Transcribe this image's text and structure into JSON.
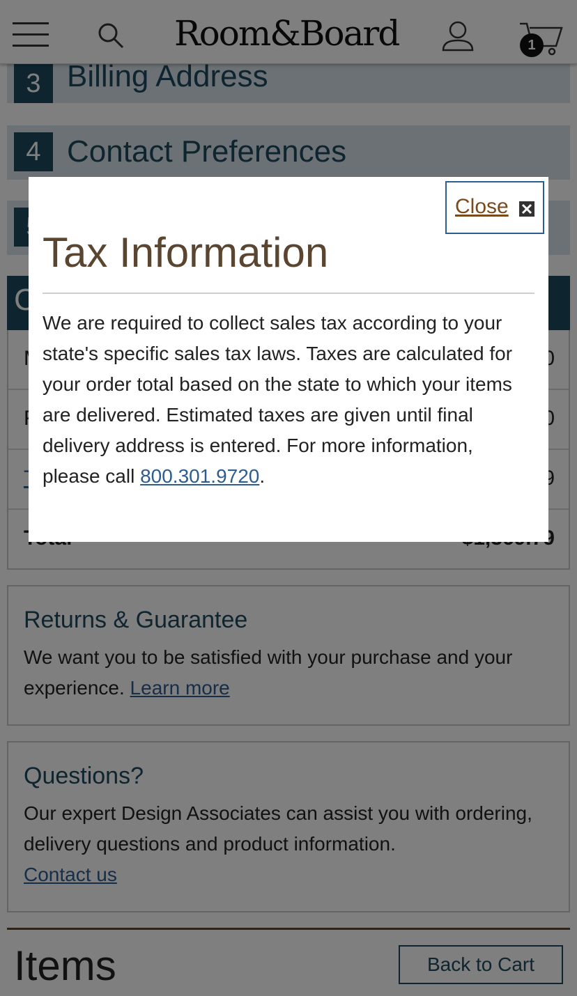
{
  "header": {
    "logo": "Room&Board",
    "cart_count": "1"
  },
  "steps": [
    {
      "num": "3",
      "title": "Billing Address"
    },
    {
      "num": "4",
      "title": "Contact Preferences"
    },
    {
      "num": "5"
    }
  ],
  "summary": {
    "heading": "C",
    "rows": [
      {
        "label": "M",
        "value": "0"
      },
      {
        "label": "F",
        "value": "0"
      },
      {
        "label": "T",
        "value": "9"
      },
      {
        "label": "Total",
        "value": "$1,369.79"
      }
    ]
  },
  "returns": {
    "title": "Returns & Guarantee",
    "text": "We want you to be satisfied with your purchase and your experience.",
    "link": "Learn more"
  },
  "questions": {
    "title": "Questions?",
    "text": "Our expert Design Associates can assist you with ordering, delivery questions and product information.",
    "link": "Contact us"
  },
  "items": {
    "title": "Items",
    "back_to_cart": "Back to Cart"
  },
  "modal": {
    "close_label": "Close",
    "title": "Tax Information",
    "body": "We are required to collect sales tax according to your state's specific sales tax laws. Taxes are calculated for your order total based on the state to which your items are delivered. Estimated taxes are given until final delivery address is entered. For more information, please call",
    "phone": "800.301.9720",
    "period": "."
  },
  "icons": {
    "menu": "hamburger-menu-icon",
    "search": "search-icon",
    "account": "user-icon",
    "cart": "cart-icon",
    "close": "close-x-icon"
  },
  "colors": {
    "brand_blue": "#1c4a5f",
    "link_blue": "#2d5d8f",
    "title_brown": "#5a4630",
    "close_brown": "#7a4a1c"
  }
}
